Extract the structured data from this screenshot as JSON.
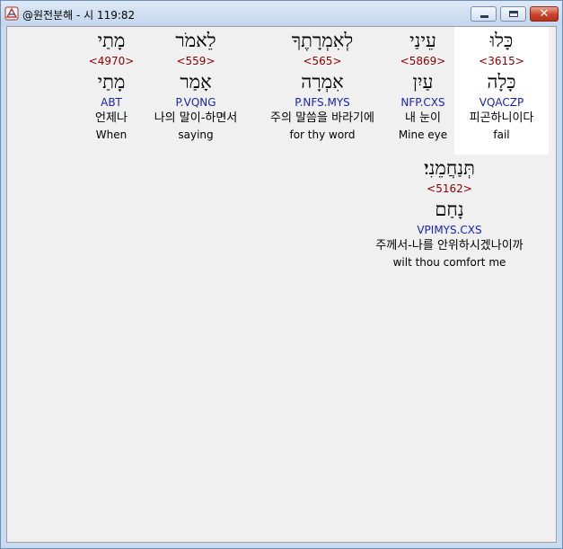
{
  "window": {
    "title": "@원전분해 - 시 119:82",
    "controls": {
      "minimize": "minimize",
      "maximize": "maximize",
      "close": "✕"
    }
  },
  "words": [
    {
      "heb": "כָּלוּ",
      "strong": "<3615>",
      "lemma": "כָּלָה",
      "morph": "VQACZP",
      "kor": "피곤하니이다",
      "eng": "fail",
      "selected": true
    },
    {
      "heb": "עֵינַי",
      "strong": "<5869>",
      "lemma": "עַיִן",
      "morph": "NFP.CXS",
      "kor": "내 눈이",
      "eng": "Mine eye",
      "selected": false
    },
    {
      "heb": "לְאִמְרָתֶךָ",
      "strong": "<565>",
      "lemma": "אִמְרָה",
      "morph": "P.NFS.MYS",
      "kor": "주의 말씀을 바라기에",
      "eng": "for thy word",
      "selected": false
    },
    {
      "heb": "לֵאמֹר",
      "strong": "<559>",
      "lemma": "אָמַר",
      "morph": "P.VQNG",
      "kor": "나의 말이-하면서",
      "eng": "saying",
      "selected": false
    },
    {
      "heb": "מָתַי",
      "strong": "<4970>",
      "lemma": "מָתַי",
      "morph": "ABT",
      "kor": "언제나",
      "eng": "When",
      "selected": false
    },
    {
      "heb": "תְּנַחֲמֵנִי׃",
      "strong": "<5162>",
      "lemma": "נָחַם",
      "morph": "VPIMYS.CXS",
      "kor": "주께서-나를 안위하시겠나이까",
      "eng": "wilt thou comfort me",
      "selected": false
    }
  ]
}
